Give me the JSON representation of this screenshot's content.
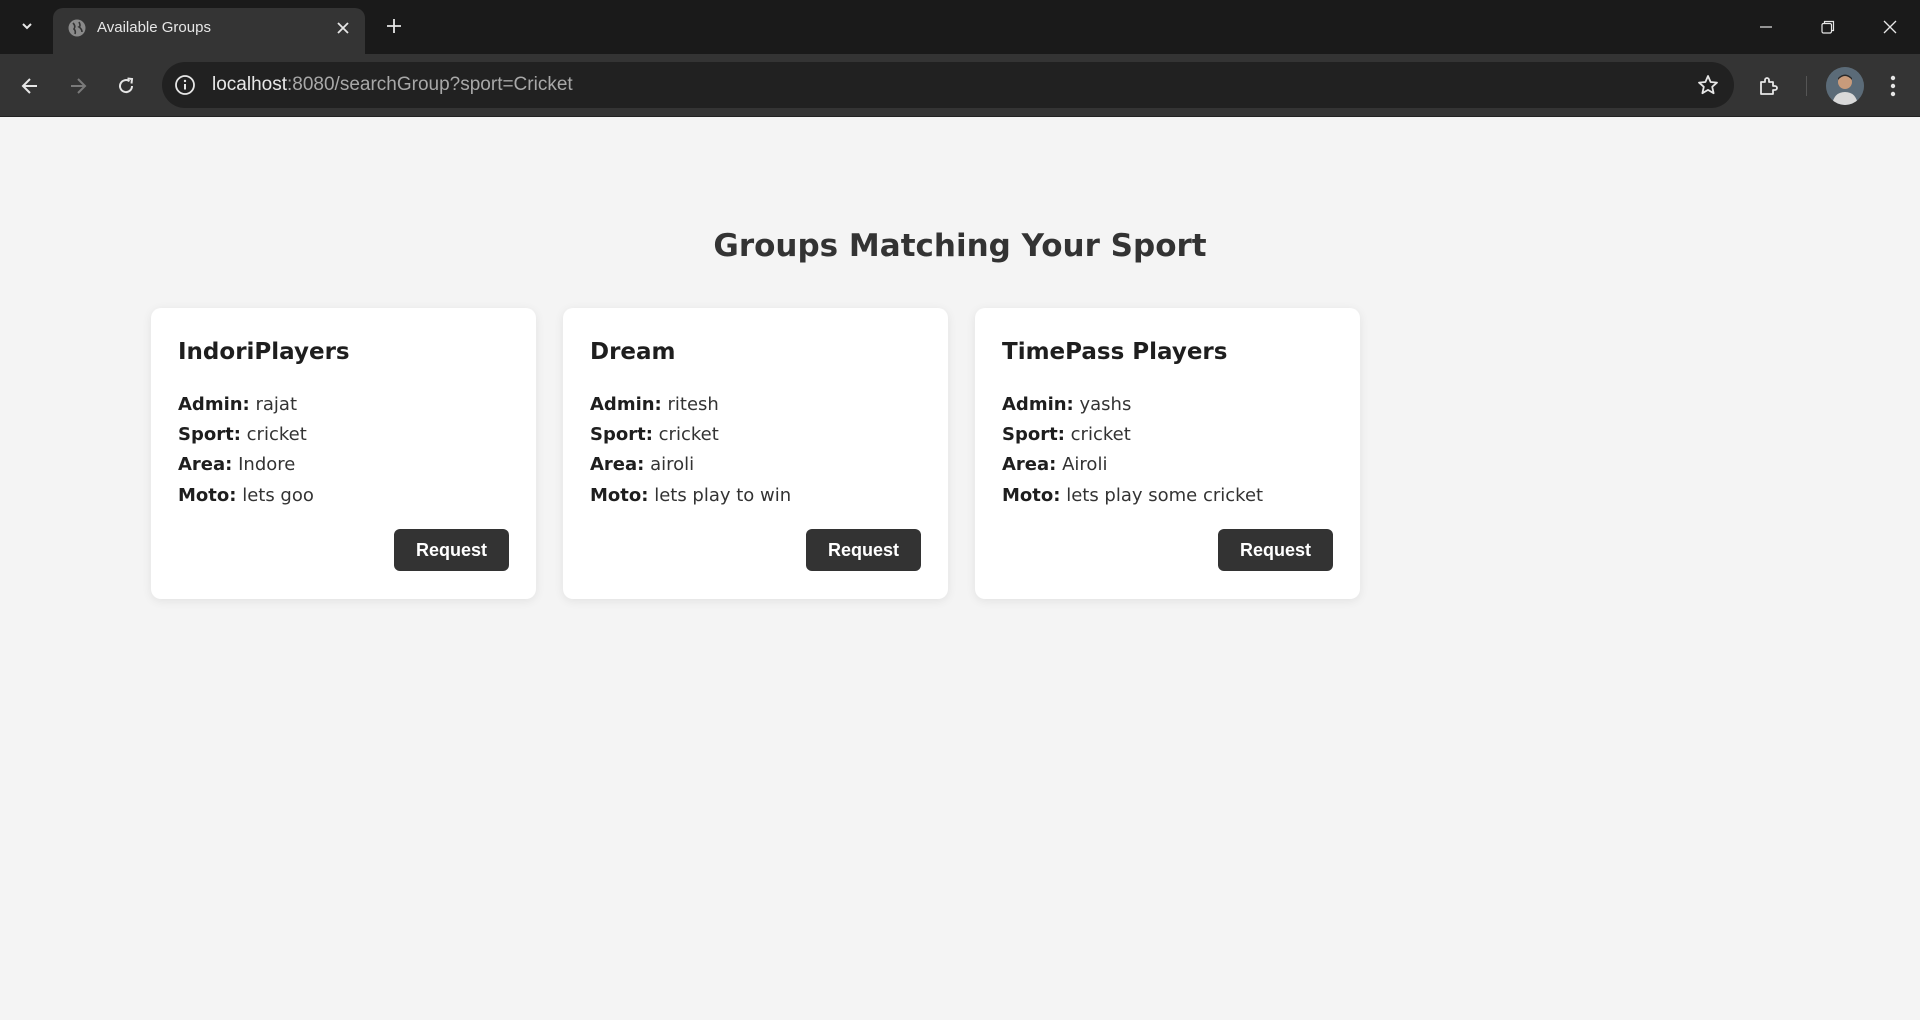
{
  "browser": {
    "tab_title": "Available Groups",
    "url_host": "localhost",
    "url_rest": ":8080/searchGroup?sport=Cricket"
  },
  "page": {
    "heading": "Groups Matching Your Sport",
    "labels": {
      "admin": "Admin:",
      "sport": "Sport:",
      "area": "Area:",
      "moto": "Moto:"
    },
    "groups": [
      {
        "name": "IndoriPlayers",
        "admin": "rajat",
        "sport": "cricket",
        "area": "Indore",
        "moto": "lets goo",
        "button": "Request"
      },
      {
        "name": "Dream",
        "admin": "ritesh",
        "sport": "cricket",
        "area": "airoli",
        "moto": "lets play to win",
        "button": "Request"
      },
      {
        "name": "TimePass Players",
        "admin": "yashs",
        "sport": "cricket",
        "area": "Airoli",
        "moto": "lets play some cricket",
        "button": "Request"
      }
    ]
  }
}
